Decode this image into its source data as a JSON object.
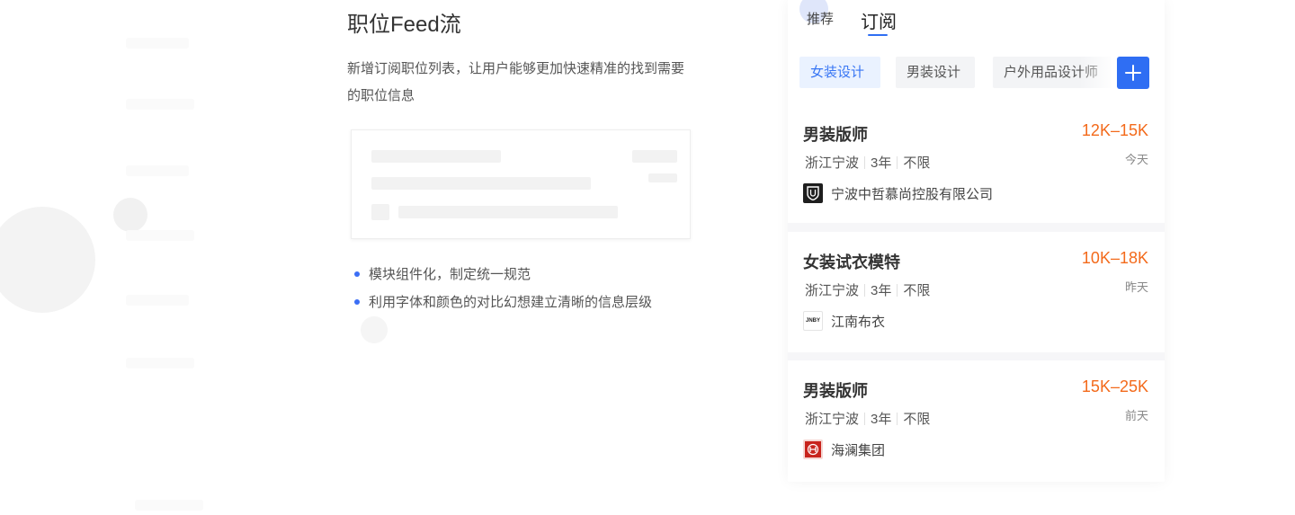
{
  "description": {
    "title": "职位Feed流",
    "text": "新增订阅职位列表，让用户能够更加快速精准的找到需要的职位信息",
    "bullets": [
      "模块组件化，制定统一规范",
      "利用字体和颜色的对比幻想建立清晰的信息层级"
    ]
  },
  "phone": {
    "tabs": {
      "recommend": "推荐",
      "subscribe": "订阅"
    },
    "chips": [
      "女装设计",
      "男装设计",
      "户外用品设计师"
    ],
    "jobs": [
      {
        "title": "男装版师",
        "salary": "12K–15K",
        "date": "今天",
        "location": "浙江宁波",
        "experience": "3年",
        "education": "不限",
        "company": "宁波中哲慕尚控股有限公司",
        "logo_icon": "shield-crest-icon"
      },
      {
        "title": "女装试衣模特",
        "salary": "10K–18K",
        "date": "昨天",
        "location": "浙江宁波",
        "experience": "3年",
        "education": "不限",
        "company": "江南布衣",
        "logo_text": "JNBY",
        "logo_icon": "jnby-logo-icon"
      },
      {
        "title": "男装版师",
        "salary": "15K–25K",
        "date": "前天",
        "location": "浙江宁波",
        "experience": "3年",
        "education": "不限",
        "company": "海澜集团",
        "logo_icon": "hla-logo-icon"
      }
    ]
  },
  "colors": {
    "accent": "#2f6ef3",
    "salary": "#f36a1b",
    "chip_active_bg": "#eaf2ff",
    "chip_active_text": "#3876f4"
  }
}
